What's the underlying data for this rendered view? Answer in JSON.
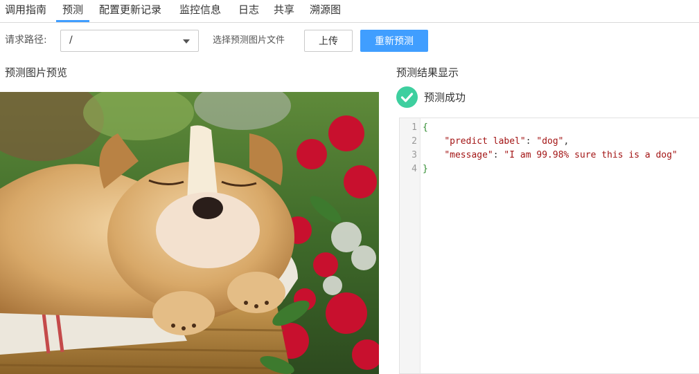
{
  "tabs": [
    {
      "label": "调用指南",
      "active": false
    },
    {
      "label": "预测",
      "active": true
    },
    {
      "label": "配置更新记录",
      "active": false
    },
    {
      "label": "监控信息",
      "active": false
    },
    {
      "label": "日志",
      "active": false
    },
    {
      "label": "共享",
      "active": false
    },
    {
      "label": "溯源图",
      "active": false
    }
  ],
  "request": {
    "path_label": "请求路径:",
    "path_value": "/",
    "file_label": "选择预测图片文件",
    "upload_label": "上传",
    "repredict_label": "重新预测"
  },
  "preview": {
    "title": "预测图片预览"
  },
  "result": {
    "title": "预测结果显示",
    "status_text": "预测成功",
    "status_icon": "check-circle-icon",
    "line_numbers": [
      "1",
      "2",
      "3",
      "4"
    ],
    "json": {
      "open": "{",
      "close": "}",
      "key1": "\"predict label\"",
      "val1": "\"dog\"",
      "key2": "\"message\"",
      "val2": "\"I am 99.98% sure this is a dog\""
    }
  },
  "colors": {
    "accent": "#409eff",
    "success": "#3ecf9f"
  }
}
